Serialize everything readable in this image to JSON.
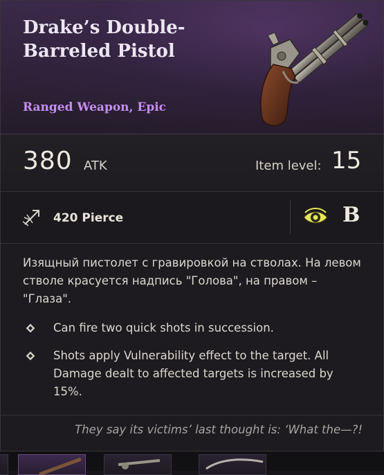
{
  "item": {
    "name": "Drake’s Double-Barreled Pistol",
    "type": "Ranged Weapon, Epic",
    "icon": "flintlock-pistol-icon"
  },
  "stats": {
    "atk_value": "380",
    "atk_label": "ATK",
    "item_level_label": "Item level:",
    "item_level_value": "15"
  },
  "attribute": {
    "icon": "pierce-arrow-icon",
    "text": "420 Pierce",
    "grade_icon": "eye-icon",
    "grade": "B"
  },
  "description": "Изящный пистолет с гравировкой на стволах. На левом стволе красуется надпись \"Голова\", на правом – \"Глаза\".",
  "traits": [
    {
      "text": "Can fire two quick shots in succession."
    },
    {
      "text": "Shots apply Vulnerability effect to the target. All Damage dealt to affected targets is increased by 15%."
    }
  ],
  "flavor": "They say its victims’ last thought is: ‘What the—?!",
  "colors": {
    "rarity_epic": "#c58ef0",
    "grade_eye": "#d6d630"
  }
}
